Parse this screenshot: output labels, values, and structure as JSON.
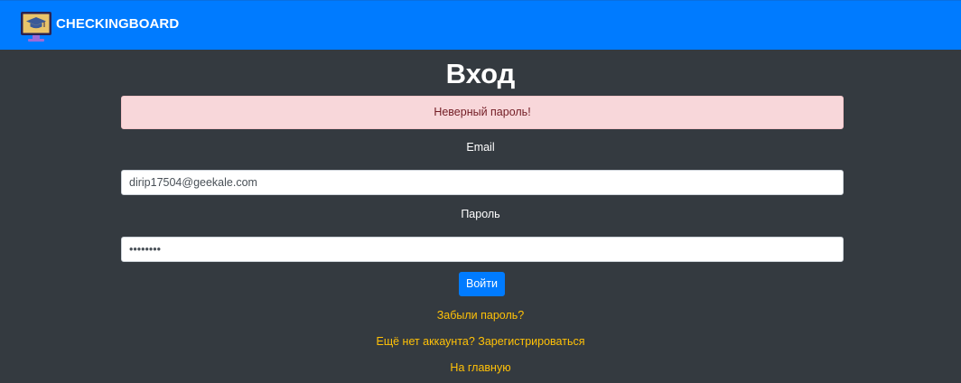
{
  "header": {
    "brand": "CHECKINGBOARD",
    "logo_icon": "graduation-cap-monitor-icon"
  },
  "page": {
    "title": "Вход"
  },
  "alert": {
    "text": "Неверный пароль!"
  },
  "form": {
    "email_label": "Email",
    "email_value": "dirip17504@geekale.com",
    "password_label": "Пароль",
    "password_value": "secretpw",
    "submit_label": "Войти"
  },
  "links": {
    "forgot": "Забыли пароль?",
    "register": "Ещё нет аккаунта? Зарегистрироваться",
    "home": "На главную"
  },
  "colors": {
    "navbar": "#007bff",
    "background": "#343a40",
    "alert_bg": "#f8d7da",
    "alert_text": "#721c24",
    "link": "#ffc107"
  }
}
